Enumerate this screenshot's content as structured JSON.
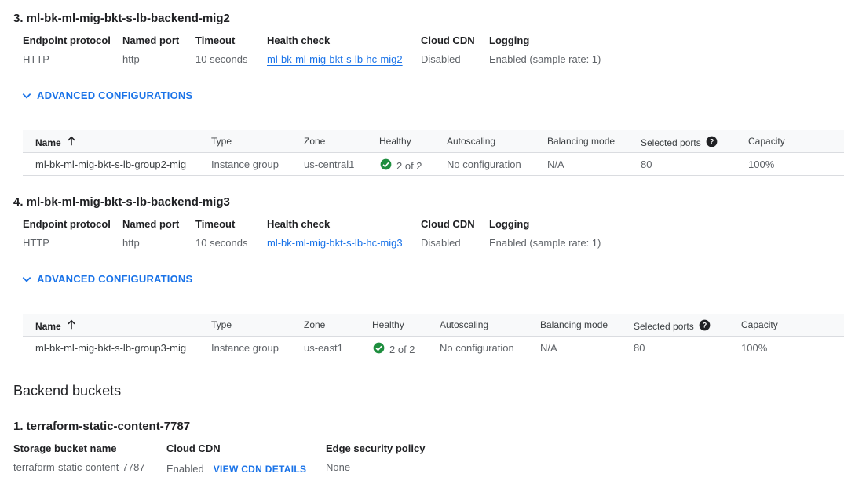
{
  "backend_services": [
    {
      "title": "3. ml-bk-ml-mig-bkt-s-lb-backend-mig2",
      "props": {
        "endpoint_protocol_label": "Endpoint protocol",
        "endpoint_protocol": "HTTP",
        "named_port_label": "Named port",
        "named_port": "http",
        "timeout_label": "Timeout",
        "timeout": "10 seconds",
        "health_check_label": "Health check",
        "health_check": "ml-bk-ml-mig-bkt-s-lb-hc-mig2",
        "cloud_cdn_label": "Cloud CDN",
        "cloud_cdn": "Disabled",
        "logging_label": "Logging",
        "logging": "Enabled (sample rate: 1)"
      },
      "advanced_label": "ADVANCED CONFIGURATIONS",
      "table": {
        "headers": {
          "name": "Name",
          "type": "Type",
          "zone": "Zone",
          "healthy": "Healthy",
          "autoscaling": "Autoscaling",
          "balancing_mode": "Balancing mode",
          "selected_ports": "Selected ports",
          "capacity": "Capacity"
        },
        "row": {
          "name": "ml-bk-ml-mig-bkt-s-lb-group2-mig",
          "type": "Instance group",
          "zone": "us-central1",
          "healthy": "2 of 2",
          "autoscaling": "No configuration",
          "balancing_mode": "N/A",
          "selected_ports": "80",
          "capacity": "100%"
        }
      }
    },
    {
      "title": "4. ml-bk-ml-mig-bkt-s-lb-backend-mig3",
      "props": {
        "endpoint_protocol_label": "Endpoint protocol",
        "endpoint_protocol": "HTTP",
        "named_port_label": "Named port",
        "named_port": "http",
        "timeout_label": "Timeout",
        "timeout": "10 seconds",
        "health_check_label": "Health check",
        "health_check": "ml-bk-ml-mig-bkt-s-lb-hc-mig3",
        "cloud_cdn_label": "Cloud CDN",
        "cloud_cdn": "Disabled",
        "logging_label": "Logging",
        "logging": "Enabled (sample rate: 1)"
      },
      "advanced_label": "ADVANCED CONFIGURATIONS",
      "table": {
        "headers": {
          "name": "Name",
          "type": "Type",
          "zone": "Zone",
          "healthy": "Healthy",
          "autoscaling": "Autoscaling",
          "balancing_mode": "Balancing mode",
          "selected_ports": "Selected ports",
          "capacity": "Capacity"
        },
        "row": {
          "name": "ml-bk-ml-mig-bkt-s-lb-group3-mig",
          "type": "Instance group",
          "zone": "us-east1",
          "healthy": "2 of 2",
          "autoscaling": "No configuration",
          "balancing_mode": "N/A",
          "selected_ports": "80",
          "capacity": "100%"
        }
      }
    }
  ],
  "backend_buckets": {
    "section_title": "Backend buckets",
    "bucket": {
      "title": "1. terraform-static-content-7787",
      "storage_bucket_name_label": "Storage bucket name",
      "storage_bucket_name": "terraform-static-content-7787",
      "cloud_cdn_label": "Cloud CDN",
      "cloud_cdn": "Enabled",
      "view_cdn_details": "VIEW CDN DETAILS",
      "edge_security_policy_label": "Edge security policy",
      "edge_security_policy": "None"
    }
  },
  "icons": {
    "sort": "arrow-up-icon",
    "help": "help-circle-icon",
    "healthy": "check-circle-icon",
    "expand": "chevron-down-icon"
  },
  "colors": {
    "link": "#1a73e8",
    "healthy": "#1e8e3e",
    "text_primary": "#202124",
    "text_secondary": "#5f6368"
  }
}
